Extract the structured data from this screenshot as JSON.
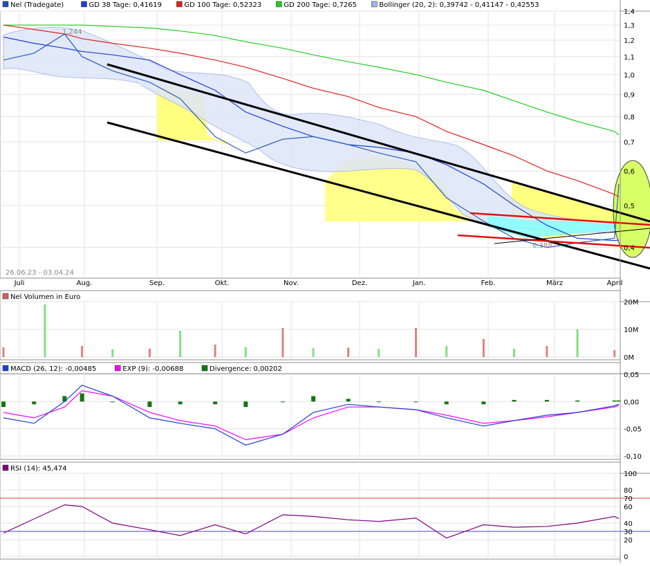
{
  "price_panel": {
    "legend": [
      {
        "label": "Nel (Tradegate)",
        "color": "#1f4fb0"
      },
      {
        "label": "GD 38 Tage: 0,41619",
        "color": "#1f3fd0"
      },
      {
        "label": "GD 100 Tage: 0,52323",
        "color": "#e02020"
      },
      {
        "label": "GD 200 Tage: 0,7265",
        "color": "#20d020"
      },
      {
        "label": "Bollinger (20, 2): 0,39742 - 0,41147 - 0,42553",
        "color": "#9fb4e8"
      }
    ],
    "y_ticks": [
      "1,4",
      "1,3",
      "1,2",
      "1,1",
      "1,0",
      "0,9",
      "0,8",
      "0,7",
      "0,6",
      "0,5",
      "0,4"
    ],
    "x_ticks": [
      "Juli",
      "Aug.",
      "Sep.",
      "Okt.",
      "Nov.",
      "Dez.",
      "Jan.",
      "Feb.",
      "März",
      "April"
    ],
    "date_range": "26.06.23 - 03.04.24",
    "max_label": "1,244",
    "min_label": "0,388"
  },
  "volume_panel": {
    "legend": [
      {
        "label": "Nel Volumen in Euro",
        "color": "#d06060"
      }
    ],
    "y_ticks": [
      "20M",
      "10M",
      "0M"
    ]
  },
  "macd_panel": {
    "legend": [
      {
        "label": "MACD (26, 12): -0,00485",
        "color": "#1f3fd0"
      },
      {
        "label": "EXP (9): -0,00688",
        "color": "#ff00ff"
      },
      {
        "label": "Divergence: 0,00202",
        "color": "#117711"
      }
    ],
    "y_ticks": [
      "0,05",
      "0,00",
      "-0,05",
      "-0,10"
    ]
  },
  "rsi_panel": {
    "legend": [
      {
        "label": "RSI (14): 45,474",
        "color": "#800080"
      }
    ],
    "y_ticks": [
      "100",
      "80",
      "70",
      "60",
      "40",
      "30",
      "20",
      "0"
    ]
  },
  "chart_data": [
    {
      "type": "line",
      "title": "Nel (Tradegate)",
      "y_scale": "log",
      "ylim": [
        0.34,
        1.4
      ],
      "x": [
        "2023-06-26",
        "2023-07-10",
        "2023-07-24",
        "2023-08-01",
        "2023-08-15",
        "2023-09-01",
        "2023-09-15",
        "2023-10-01",
        "2023-10-15",
        "2023-11-01",
        "2023-11-15",
        "2023-12-01",
        "2023-12-15",
        "2024-01-01",
        "2024-01-15",
        "2024-02-01",
        "2024-02-15",
        "2024-03-01",
        "2024-03-15",
        "2024-04-01",
        "2024-04-03"
      ],
      "series": [
        {
          "name": "Nel (Tradegate)",
          "values": [
            1.08,
            1.12,
            1.24,
            1.1,
            1.02,
            0.96,
            0.88,
            0.72,
            0.66,
            0.71,
            0.72,
            0.69,
            0.66,
            0.63,
            0.52,
            0.46,
            0.42,
            0.4,
            0.41,
            0.42,
            0.56
          ]
        },
        {
          "name": "GD 38 Tage",
          "values": [
            1.22,
            1.18,
            1.15,
            1.13,
            1.11,
            1.08,
            1.0,
            0.92,
            0.82,
            0.76,
            0.72,
            0.69,
            0.68,
            0.66,
            0.62,
            0.56,
            0.5,
            0.45,
            0.42,
            0.415,
            0.416
          ]
        },
        {
          "name": "GD 100 Tage",
          "values": [
            1.3,
            1.27,
            1.24,
            1.21,
            1.18,
            1.15,
            1.12,
            1.08,
            1.04,
            0.98,
            0.93,
            0.89,
            0.84,
            0.8,
            0.74,
            0.69,
            0.65,
            0.6,
            0.57,
            0.53,
            0.523
          ]
        },
        {
          "name": "GD 200 Tage",
          "values": [
            1.3,
            1.3,
            1.3,
            1.3,
            1.29,
            1.28,
            1.26,
            1.23,
            1.19,
            1.15,
            1.11,
            1.07,
            1.04,
            1.0,
            0.96,
            0.92,
            0.87,
            0.82,
            0.78,
            0.74,
            0.7265
          ]
        }
      ]
    },
    {
      "type": "bar",
      "title": "Nel Volumen in Euro",
      "ylim": [
        0,
        20000000
      ],
      "x": [
        "2023-06-26",
        "2023-07-15",
        "2023-08-01",
        "2023-08-15",
        "2023-09-01",
        "2023-09-15",
        "2023-10-01",
        "2023-10-15",
        "2023-11-01",
        "2023-11-15",
        "2023-12-01",
        "2023-12-15",
        "2024-01-01",
        "2024-01-15",
        "2024-02-01",
        "2024-02-15",
        "2024-03-01",
        "2024-03-15",
        "2024-04-01"
      ],
      "series": [
        {
          "name": "Nel Volumen in Euro",
          "values": [
            3500000,
            19000000,
            4000000,
            2800000,
            3000000,
            9500000,
            4500000,
            3600000,
            10500000,
            3200000,
            3400000,
            3000000,
            10500000,
            4000000,
            6500000,
            3000000,
            4000000,
            10000000,
            2500000
          ]
        }
      ]
    },
    {
      "type": "line",
      "title": "MACD (26, 12)",
      "ylim": [
        -0.1,
        0.05
      ],
      "x": [
        "2023-06-26",
        "2023-07-10",
        "2023-07-24",
        "2023-08-01",
        "2023-08-15",
        "2023-09-01",
        "2023-09-15",
        "2023-10-01",
        "2023-10-15",
        "2023-11-01",
        "2023-11-15",
        "2023-12-01",
        "2023-12-15",
        "2024-01-01",
        "2024-01-15",
        "2024-02-01",
        "2024-02-15",
        "2024-03-01",
        "2024-03-15",
        "2024-04-01",
        "2024-04-03"
      ],
      "series": [
        {
          "name": "MACD (26, 12)",
          "values": [
            -0.03,
            -0.04,
            0.0,
            0.03,
            0.01,
            -0.03,
            -0.04,
            -0.05,
            -0.08,
            -0.06,
            -0.02,
            -0.005,
            -0.01,
            -0.015,
            -0.03,
            -0.045,
            -0.035,
            -0.025,
            -0.02,
            -0.008,
            -0.00485
          ]
        },
        {
          "name": "EXP (9)",
          "values": [
            -0.02,
            -0.03,
            -0.01,
            0.02,
            0.01,
            -0.02,
            -0.035,
            -0.045,
            -0.07,
            -0.06,
            -0.03,
            -0.01,
            -0.01,
            -0.015,
            -0.025,
            -0.04,
            -0.035,
            -0.028,
            -0.02,
            -0.01,
            -0.00688
          ]
        },
        {
          "name": "Divergence",
          "values": [
            -0.01,
            -0.005,
            0.01,
            0.015,
            0.0,
            -0.01,
            -0.005,
            -0.005,
            -0.01,
            0.0,
            0.01,
            0.005,
            0.0,
            0.0,
            -0.005,
            -0.005,
            0.003,
            0.003,
            0.002,
            0.002,
            0.00202
          ]
        }
      ]
    },
    {
      "type": "line",
      "title": "RSI (14)",
      "ylim": [
        0,
        100
      ],
      "x": [
        "2023-06-26",
        "2023-07-10",
        "2023-07-24",
        "2023-08-01",
        "2023-08-15",
        "2023-09-01",
        "2023-09-15",
        "2023-10-01",
        "2023-10-15",
        "2023-11-01",
        "2023-11-15",
        "2023-12-01",
        "2023-12-15",
        "2024-01-01",
        "2024-01-15",
        "2024-02-01",
        "2024-02-15",
        "2024-03-01",
        "2024-03-15",
        "2024-04-01",
        "2024-04-03"
      ],
      "series": [
        {
          "name": "RSI (14)",
          "values": [
            28,
            45,
            62,
            60,
            40,
            32,
            25,
            38,
            27,
            50,
            48,
            44,
            42,
            46,
            22,
            38,
            35,
            36,
            40,
            48,
            45.474
          ]
        }
      ]
    }
  ]
}
